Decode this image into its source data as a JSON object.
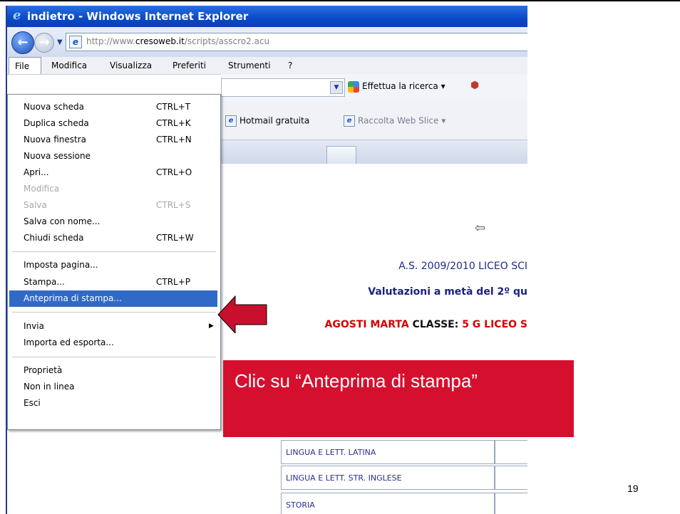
{
  "window": {
    "title": "indietro - Windows Internet Explorer"
  },
  "address": {
    "url_prefix": "http://www.",
    "url_domain": "cresoweb.it",
    "url_path": "/scripts/asscro2.acu"
  },
  "menubar": {
    "items": [
      "File",
      "Modifica",
      "Visualizza",
      "Preferiti",
      "Strumenti",
      "?"
    ]
  },
  "toolbar": {
    "search_label": "Effettua la ricerca ▾",
    "fav1": "Hotmail gratuita",
    "fav2": "Raccolta Web Slice ▾"
  },
  "file_menu": {
    "items": [
      {
        "label": "Nuova scheda",
        "shortcut": "CTRL+T"
      },
      {
        "label": "Duplica scheda",
        "shortcut": "CTRL+K"
      },
      {
        "label": "Nuova finestra",
        "shortcut": "CTRL+N"
      },
      {
        "label": "Nuova sessione",
        "shortcut": ""
      },
      {
        "label": "Apri...",
        "shortcut": "CTRL+O"
      },
      {
        "label": "Modifica",
        "shortcut": ""
      },
      {
        "label": "Salva",
        "shortcut": "CTRL+S"
      },
      {
        "label": "Salva con nome...",
        "shortcut": ""
      },
      {
        "label": "Chiudi scheda",
        "shortcut": "CTRL+W"
      },
      {
        "label": "Imposta pagina...",
        "shortcut": ""
      },
      {
        "label": "Stampa...",
        "shortcut": "CTRL+P"
      },
      {
        "label": "Anteprima di stampa...",
        "shortcut": ""
      },
      {
        "label": "Invia",
        "shortcut": ""
      },
      {
        "label": "Importa ed esporta...",
        "shortcut": ""
      },
      {
        "label": "Proprietà",
        "shortcut": ""
      },
      {
        "label": "Non in linea",
        "shortcut": ""
      },
      {
        "label": "Esci",
        "shortcut": ""
      }
    ]
  },
  "content": {
    "line1": "A.S. 2009/2010 LICEO SCI",
    "line2": "Valutazioni a metà del 2º qu",
    "student_name": "AGOSTI MARTA",
    "class_label": "CLASSE:",
    "class_value": "5 G LICEO S",
    "subjects": [
      "LINGUA E LETT. LATINA",
      "LINGUA E LETT. STR. INGLESE",
      "STORIA"
    ]
  },
  "callout": {
    "text": "Clic su “Anteprima di stampa”"
  },
  "slide": {
    "page_number": "19"
  },
  "colors": {
    "callout": "#d4102e",
    "menu_highlight": "#3169c6",
    "title_bar": "#0a49c7"
  }
}
